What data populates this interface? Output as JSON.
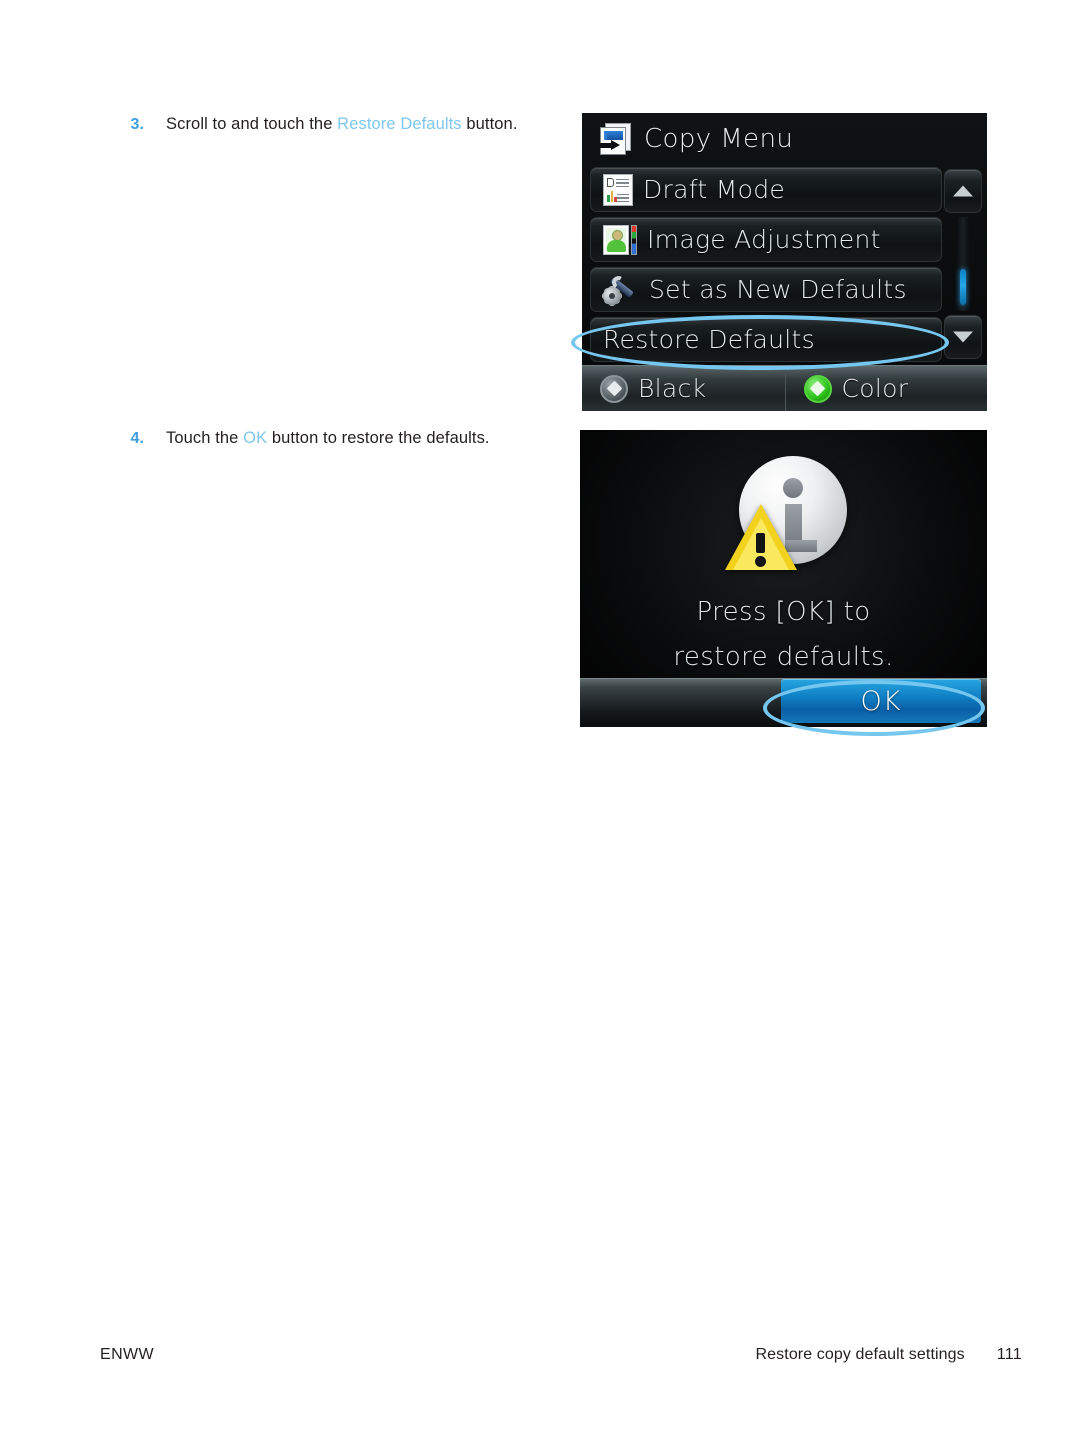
{
  "document": {
    "steps": [
      {
        "number": "3.",
        "text_before": "Scroll to and touch the ",
        "highlight": "Restore Defaults",
        "text_after": " button."
      },
      {
        "number": "4.",
        "text_before": "Touch the ",
        "highlight": "OK",
        "text_after": " button to restore the defaults."
      }
    ],
    "footer": {
      "left": "ENWW",
      "section_title": "Restore copy default settings",
      "page_number": "111"
    }
  },
  "screenshot_copy_menu": {
    "header": {
      "icon": "copy-icon",
      "title": "Copy Menu"
    },
    "rows": [
      {
        "icon": "document-draft-icon",
        "label": "Draft Mode"
      },
      {
        "icon": "image-person-icon",
        "label": "Image Adjustment"
      },
      {
        "icon": "wrench-gear-icon",
        "label": "Set as New Defaults"
      },
      {
        "icon": "none",
        "label": "Restore Defaults"
      }
    ],
    "scrollbar": {
      "up_icon": "triangle-up-icon",
      "down_icon": "triangle-down-icon"
    },
    "start_buttons": [
      {
        "icon": "start-black-icon",
        "label": "Black"
      },
      {
        "icon": "start-color-icon",
        "label": "Color"
      }
    ]
  },
  "screenshot_confirm_dialog": {
    "icon": "info-warning-icon",
    "message_line1": "Press [OK] to",
    "message_line2": "restore defaults.",
    "ok_label": "OK"
  },
  "colors": {
    "accent_blue": "#7ec7f0",
    "callout_blue": "#76c7ef",
    "step_number_blue": "#3f9fe0",
    "ok_button_blue": "#0f7ec4",
    "text_black": "#231f20"
  }
}
